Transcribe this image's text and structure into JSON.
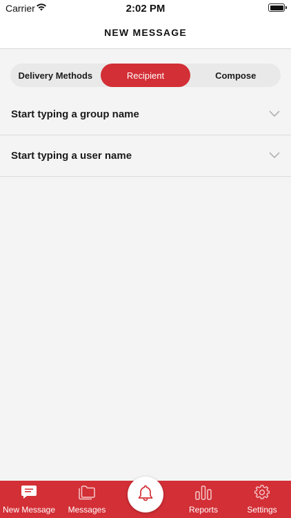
{
  "status_bar": {
    "carrier": "Carrier",
    "time": "2:02 PM",
    "wifi_icon": "wifi-icon",
    "battery_icon": "battery-icon"
  },
  "nav": {
    "title": "NEW MESSAGE"
  },
  "segments": {
    "items": [
      {
        "label": "Delivery Methods",
        "active": false
      },
      {
        "label": "Recipient",
        "active": true
      },
      {
        "label": "Compose",
        "active": false
      }
    ]
  },
  "recipient_fields": [
    {
      "label": "Start typing a group name",
      "icon": "chevron-down-icon"
    },
    {
      "label": "Start typing a user name",
      "icon": "chevron-down-icon"
    }
  ],
  "tab_bar": {
    "tabs": [
      {
        "label": "New Message",
        "icon": "compose-icon",
        "selected": true
      },
      {
        "label": "Messages",
        "icon": "folder-icon",
        "selected": false
      },
      {
        "label": "Reports",
        "icon": "bar-chart-icon",
        "selected": false
      },
      {
        "label": "Settings",
        "icon": "gear-icon",
        "selected": false
      }
    ],
    "center_action_icon": "bell-icon"
  },
  "colors": {
    "accent": "#d32f36",
    "background": "#f4f4f4",
    "segment_track": "#e9e9e9"
  }
}
